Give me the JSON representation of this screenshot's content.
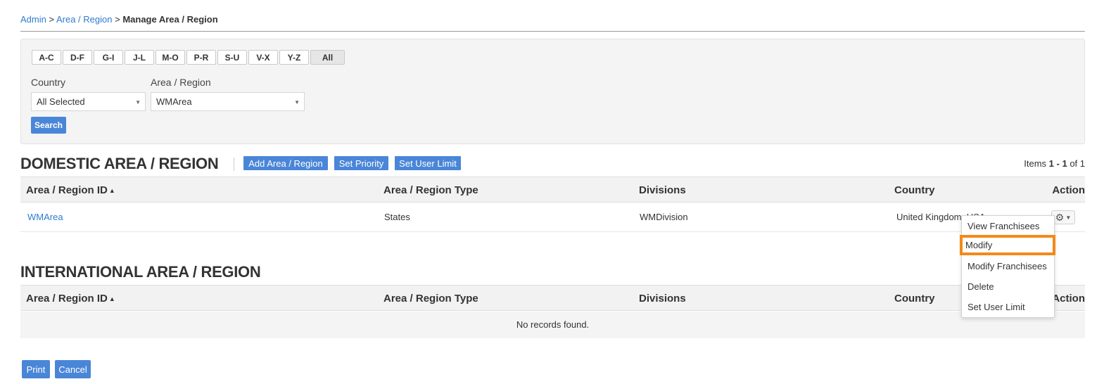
{
  "breadcrumb": {
    "admin": "Admin",
    "sep1": ">",
    "area_region": "Area / Region",
    "sep2": ">",
    "current": "Manage Area / Region"
  },
  "filter": {
    "alpha": [
      "A-C",
      "D-F",
      "G-I",
      "J-L",
      "M-O",
      "P-R",
      "S-U",
      "V-X",
      "Y-Z",
      "All"
    ],
    "country_label": "Country",
    "country_value": "All Selected",
    "area_label": "Area / Region",
    "area_value": "WMArea",
    "search_label": "Search"
  },
  "domestic": {
    "title": "DOMESTIC AREA / REGION",
    "add_label": "Add Area / Region",
    "priority_label": "Set Priority",
    "user_limit_label": "Set User Limit",
    "items_prefix": "Items",
    "items_range": "1 - 1",
    "items_of": "of 1",
    "columns": [
      "Area / Region ID",
      "Area / Region Type",
      "Divisions",
      "Country",
      "Action"
    ],
    "rows": [
      {
        "id": "WMArea",
        "type": "States",
        "divisions": "WMDivision",
        "country": "United Kingdom, USA"
      }
    ]
  },
  "international": {
    "title": "INTERNATIONAL AREA / REGION",
    "columns": [
      "Area / Region ID",
      "Area / Region Type",
      "Divisions",
      "Country",
      "Action"
    ],
    "empty_text": "No records found."
  },
  "action_menu": {
    "items": [
      "View Franchisees",
      "Modify",
      "Modify Franchisees",
      "Delete",
      "Set User Limit"
    ],
    "highlighted": "Modify"
  },
  "footer": {
    "print_label": "Print",
    "cancel_label": "Cancel"
  },
  "colors": {
    "primary": "#4a86d8",
    "link": "#2f7bd1",
    "highlight": "#f28a1a"
  }
}
